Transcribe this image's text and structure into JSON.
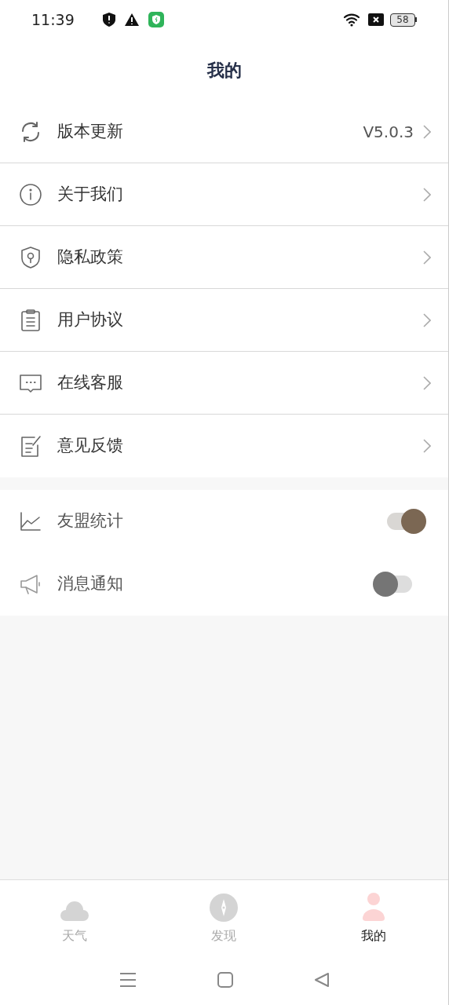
{
  "status_bar": {
    "time": "11:39",
    "battery": "58"
  },
  "title": "我的",
  "menu_items": [
    {
      "label": "版本更新",
      "value": "V5.0.3"
    },
    {
      "label": "关于我们"
    },
    {
      "label": "隐私政策"
    },
    {
      "label": "用户协议"
    },
    {
      "label": "在线客服"
    },
    {
      "label": "意见反馈"
    }
  ],
  "toggles": [
    {
      "label": "友盟统计",
      "on": true
    },
    {
      "label": "消息通知",
      "on": false
    }
  ],
  "tabs": [
    {
      "label": "天气",
      "selected": false
    },
    {
      "label": "发现",
      "selected": false
    },
    {
      "label": "我的",
      "selected": true
    }
  ]
}
